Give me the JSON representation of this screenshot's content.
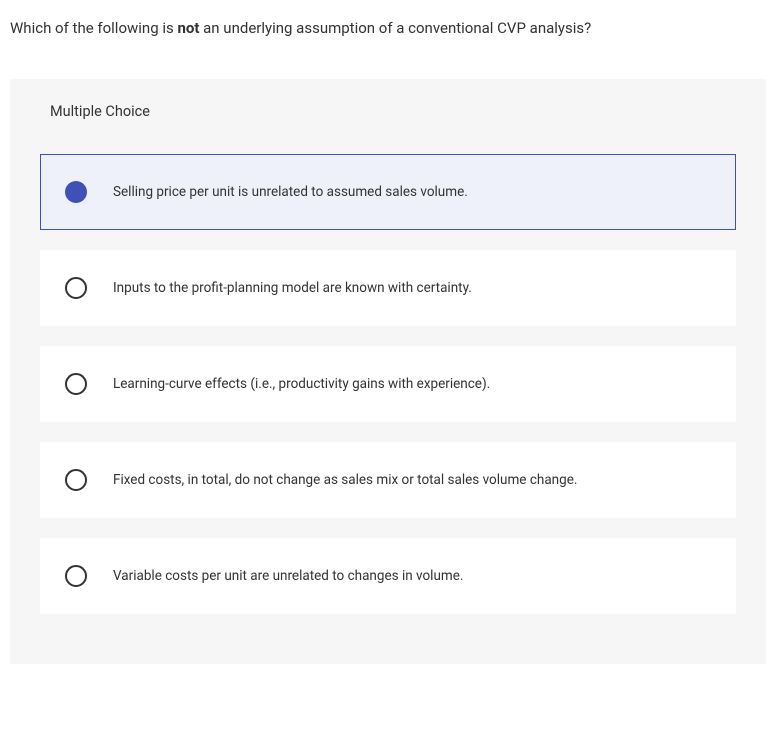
{
  "question": {
    "prefix": "Which of the following is ",
    "emphasis": "not",
    "suffix": " an underlying assumption of a conventional CVP analysis?"
  },
  "mc_label": "Multiple Choice",
  "options": [
    {
      "label": "Selling price per unit is unrelated to assumed sales volume.",
      "selected": true
    },
    {
      "label": "Inputs to the profit-planning model are known with certainty.",
      "selected": false
    },
    {
      "label": "Learning-curve effects (i.e., productivity gains with experience).",
      "selected": false
    },
    {
      "label": "Fixed costs, in total, do not change as sales mix or total sales volume change.",
      "selected": false
    },
    {
      "label": "Variable costs per unit are unrelated to changes in volume.",
      "selected": false
    }
  ]
}
